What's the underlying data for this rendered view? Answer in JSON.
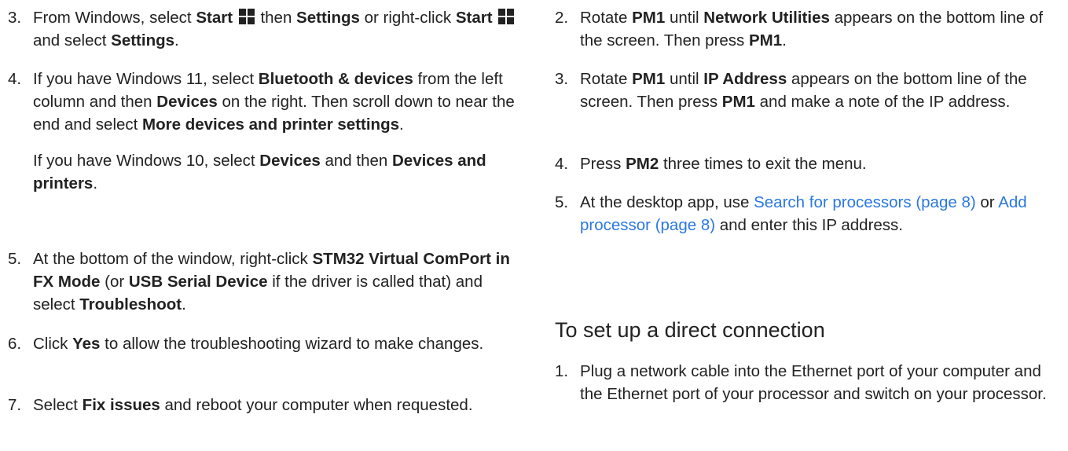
{
  "left": {
    "s3": {
      "num": "3.",
      "t1": "From Windows, select ",
      "b1": "Start",
      "t2": " then ",
      "b2": "Settings",
      "t3": " or right-click ",
      "b3": "Start",
      "t4": " and select ",
      "b4": "Settings",
      "t5": "."
    },
    "s4": {
      "num": "4.",
      "t1": "If you have Windows 11, select ",
      "b1": "Bluetooth & devices",
      "t2": " from the left column and then ",
      "b2": "Devices",
      "t3": " on the right. Then scroll down to near the end and select ",
      "b3": "More devices and printer settings",
      "t4": ".",
      "sub": {
        "t1": "If you have Windows 10, select ",
        "b1": "Devices",
        "t2": " and then ",
        "b2": "Devices and printers",
        "t3": "."
      }
    },
    "s5": {
      "num": "5.",
      "t1": "At the bottom of the window, right-click ",
      "b1": "STM32 Virtual ComPort in FX Mode",
      "t2": " (or ",
      "b2": "USB Serial Device",
      "t3": " if the driver is called that) and select ",
      "b3": "Troubleshoot",
      "t4": "."
    },
    "s6": {
      "num": "6.",
      "t1": "Click ",
      "b1": "Yes",
      "t2": " to allow the troubleshooting wizard to make changes."
    },
    "s7": {
      "num": "7.",
      "t1": "Select ",
      "b1": "Fix issues",
      "t2": " and reboot your computer when requested."
    }
  },
  "right": {
    "s2": {
      "num": "2.",
      "t1": "Rotate ",
      "b1": "PM1",
      "t2": " until ",
      "b2": "Network Utilities",
      "t3": " appears on the bottom line of the screen. Then press ",
      "b3": "PM1",
      "t4": "."
    },
    "s3": {
      "num": "3.",
      "t1": "Rotate ",
      "b1": "PM1",
      "t2": " until ",
      "b2": "IP Address",
      "t3": " appears on the bottom line of the screen. Then press ",
      "b3": "PM1",
      "t4": " and make a note of the IP address."
    },
    "s4": {
      "num": "4.",
      "t1": "Press ",
      "b1": "PM2",
      "t2": " three times to exit the menu."
    },
    "s5": {
      "num": "5.",
      "t1": "At the desktop app, use ",
      "l1": "Search for processors (page 8)",
      "t2": " or ",
      "l2": "Add processor (page 8)",
      "t3": " and enter this IP address."
    },
    "heading": "To set up a direct connection",
    "d1": {
      "num": "1.",
      "t1": "Plug a network cable into the Ethernet port of your computer and the Ethernet port of your processor and switch on your processor."
    }
  },
  "icons": {
    "start": "windows-logo-icon"
  },
  "colors": {
    "text": "#222222",
    "link": "#2b78e0"
  }
}
